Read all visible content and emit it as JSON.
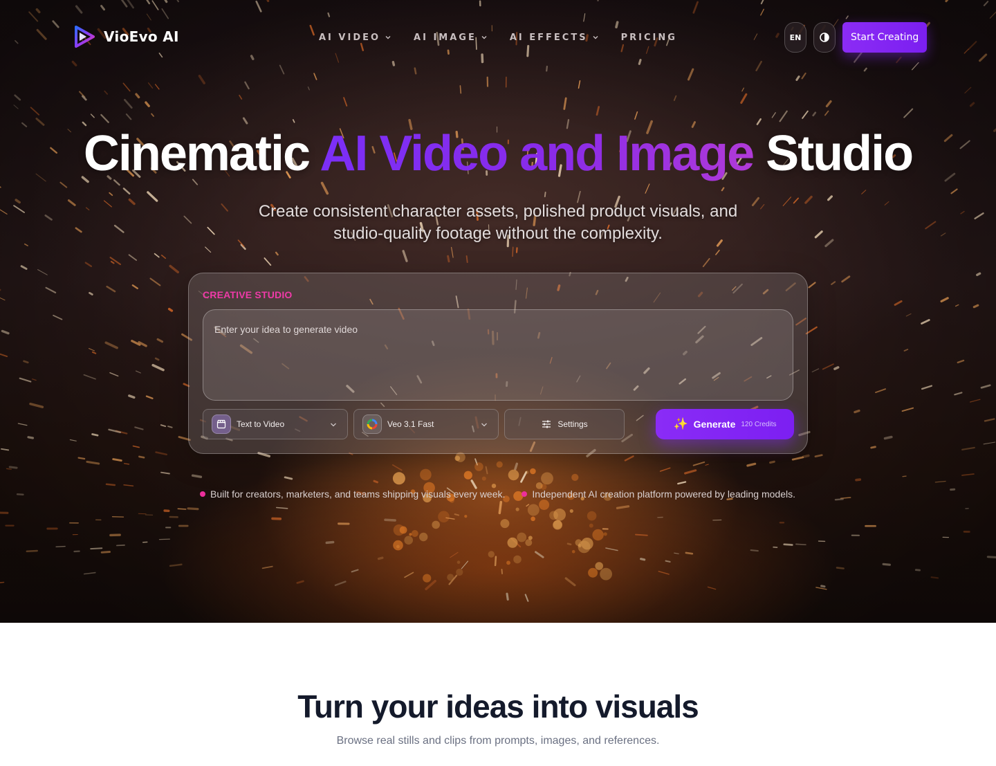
{
  "brand": {
    "name": "VioEvo AI"
  },
  "nav": {
    "links": [
      {
        "label": "AI VIDEO",
        "dropdown": true
      },
      {
        "label": "AI IMAGE",
        "dropdown": true
      },
      {
        "label": "AI EFFECTS",
        "dropdown": true
      },
      {
        "label": "PRICING",
        "dropdown": false
      }
    ],
    "language": "EN",
    "cta": "Start Creating"
  },
  "hero": {
    "title_before": "Cinematic ",
    "title_highlight": "AI Video and Image",
    "title_after": " Studio",
    "subtitle": "Create consistent character assets, polished product visuals, and studio-quality footage without the complexity."
  },
  "studio": {
    "label": "CREATIVE STUDIO",
    "prompt_placeholder": "Enter your idea to generate video",
    "mode": "Text to Video",
    "model": "Veo 3.1 Fast",
    "settings_label": "Settings",
    "generate_label": "Generate",
    "credits": "120 Credits"
  },
  "bullets": [
    "Built for creators, marketers, and teams shipping visuals every week.",
    "Independent AI creation platform powered by leading models."
  ],
  "section": {
    "title": "Turn your ideas into visuals",
    "subtitle": "Browse real stills and clips from prompts, images, and references."
  },
  "colors": {
    "accent": "#7b1ff0",
    "pink": "#ec2f9b",
    "headline_dark": "#141a2b"
  }
}
